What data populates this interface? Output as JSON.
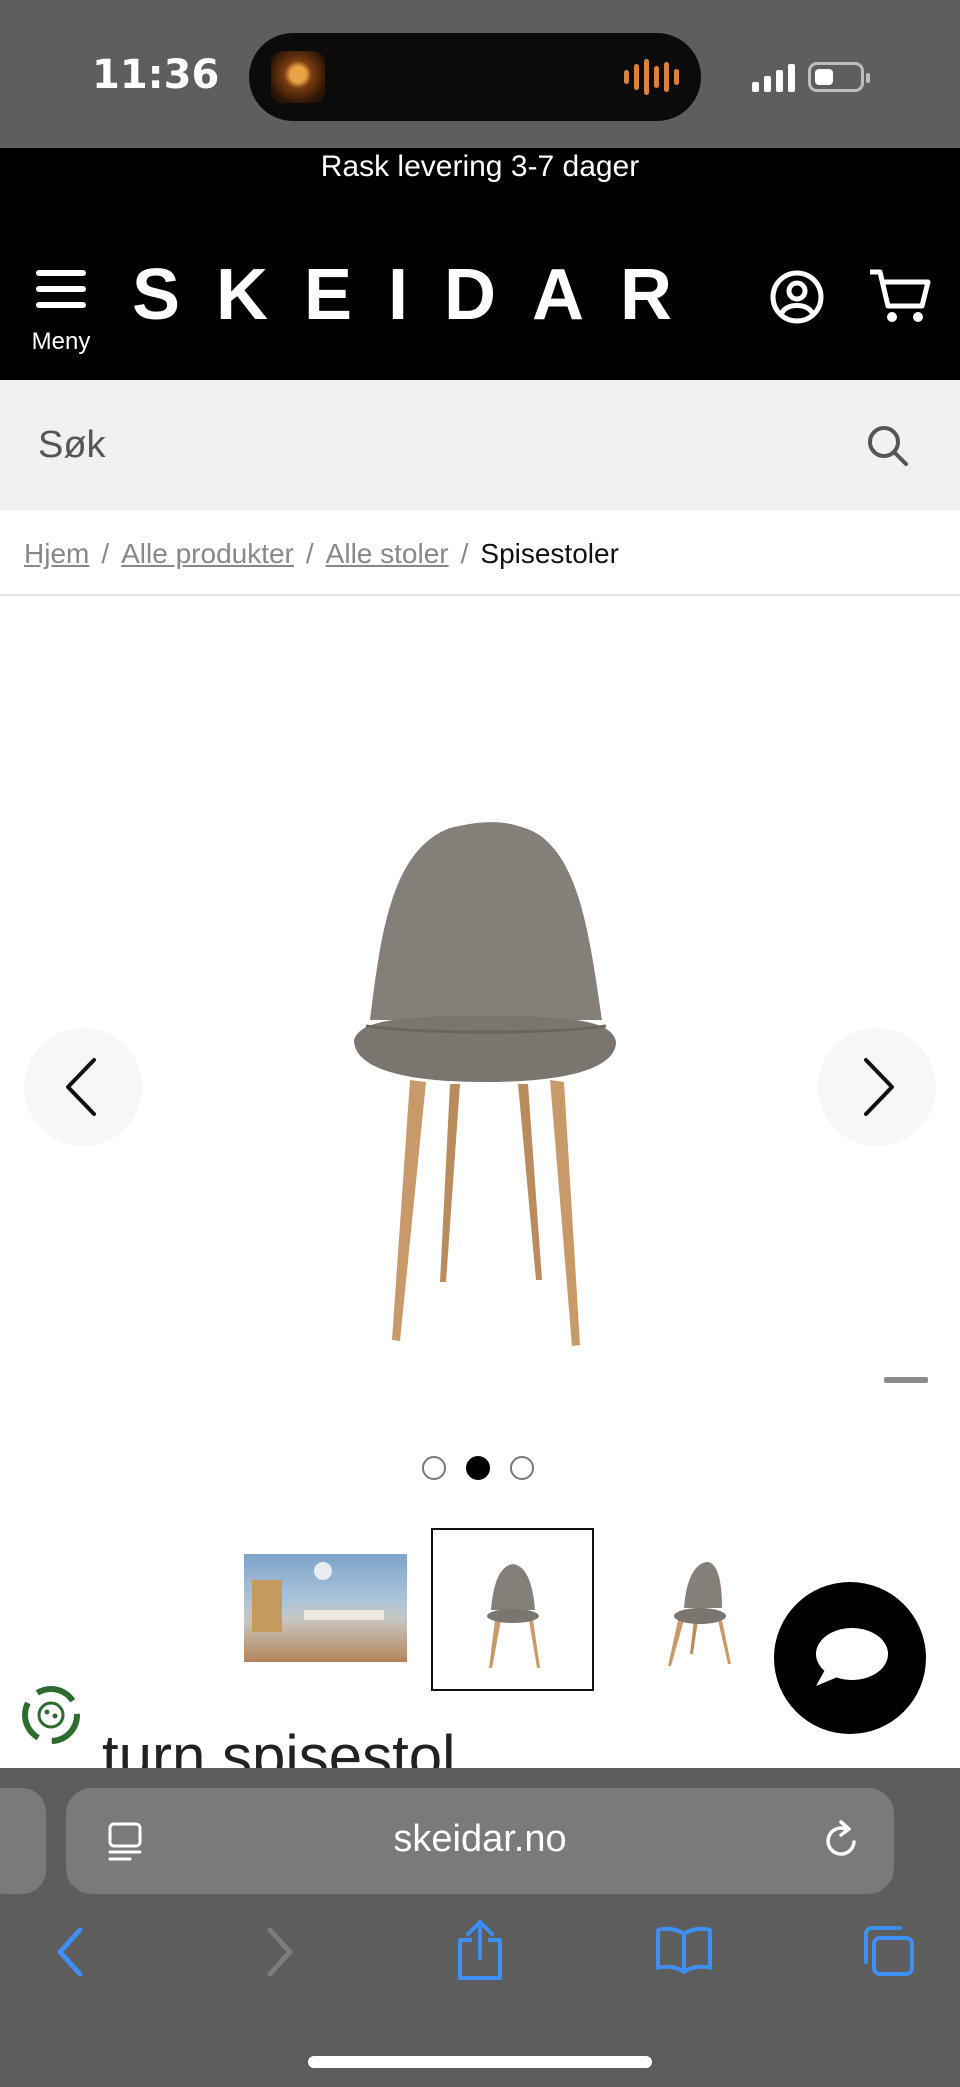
{
  "status_bar": {
    "time": "11:36"
  },
  "promo": {
    "text": "Rask levering 3-7 dager"
  },
  "header": {
    "menu_label": "Meny",
    "logo": "SKEIDAR"
  },
  "search": {
    "placeholder": "Søk"
  },
  "breadcrumb": {
    "items": [
      "Hjem",
      "Alle produkter",
      "Alle stoler"
    ],
    "separator": "/",
    "current": "Spisestoler"
  },
  "gallery": {
    "slide_count": 3,
    "active_slide": 2,
    "thumbnails": [
      "room-scene",
      "chair-front",
      "chair-angle"
    ],
    "selected_thumbnail": 2
  },
  "product": {
    "title_visible": "turn spisestol"
  },
  "browser": {
    "url": "skeidar.no"
  },
  "colors": {
    "header_bg": "#000000",
    "search_bg": "#f1f1f1",
    "browser_chrome": "#5d5d5d",
    "ios_blue": "#3d8ff5"
  }
}
